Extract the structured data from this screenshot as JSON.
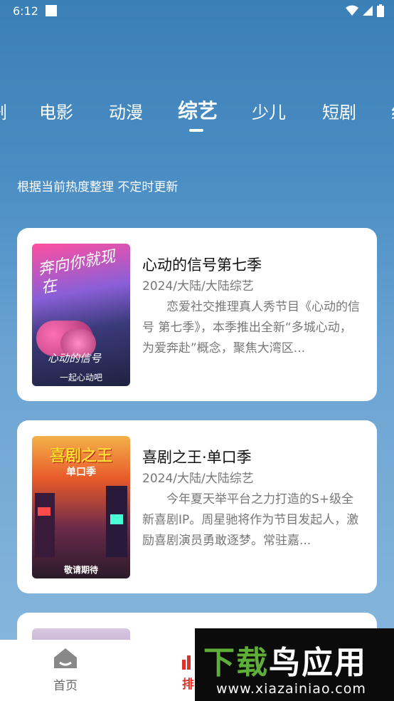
{
  "status_bar": {
    "time": "6:12"
  },
  "tabs": [
    {
      "label": "剧",
      "active": false
    },
    {
      "label": "电影",
      "active": false
    },
    {
      "label": "动漫",
      "active": false
    },
    {
      "label": "综艺",
      "active": true
    },
    {
      "label": "少儿",
      "active": false
    },
    {
      "label": "短剧",
      "active": false
    },
    {
      "label": "纪",
      "active": false
    }
  ],
  "subtitle": "根据当前热度整理 不定时更新",
  "cards": [
    {
      "title": "心动的信号第七季",
      "meta": "2024/大陆/大陆综艺",
      "description": "恋爱社交推理真人秀节目《心动的信号 第七季》，本季推出全新“多城心动，为爱奔赴”概念，聚焦大湾区...",
      "poster": {
        "headline": "奔向你就现在",
        "logo": "心动的信号",
        "footer": "一起心动吧"
      }
    },
    {
      "title": "喜剧之王·单口季",
      "meta": "2024/大陆/大陆综艺",
      "description": "今年夏天举平台之力打造的S+级全新喜剧IP。周星驰将作为节目发起人，激励喜剧演员勇敢逐梦。常驻嘉...",
      "poster": {
        "headline": "喜剧之王",
        "sub": "单口季",
        "footer": "敬请期待"
      }
    }
  ],
  "bottom_nav": {
    "home": "首页",
    "rank": "排"
  },
  "watermark": {
    "title": "下载鸟应用",
    "url": "www.xiazainiao.com"
  }
}
